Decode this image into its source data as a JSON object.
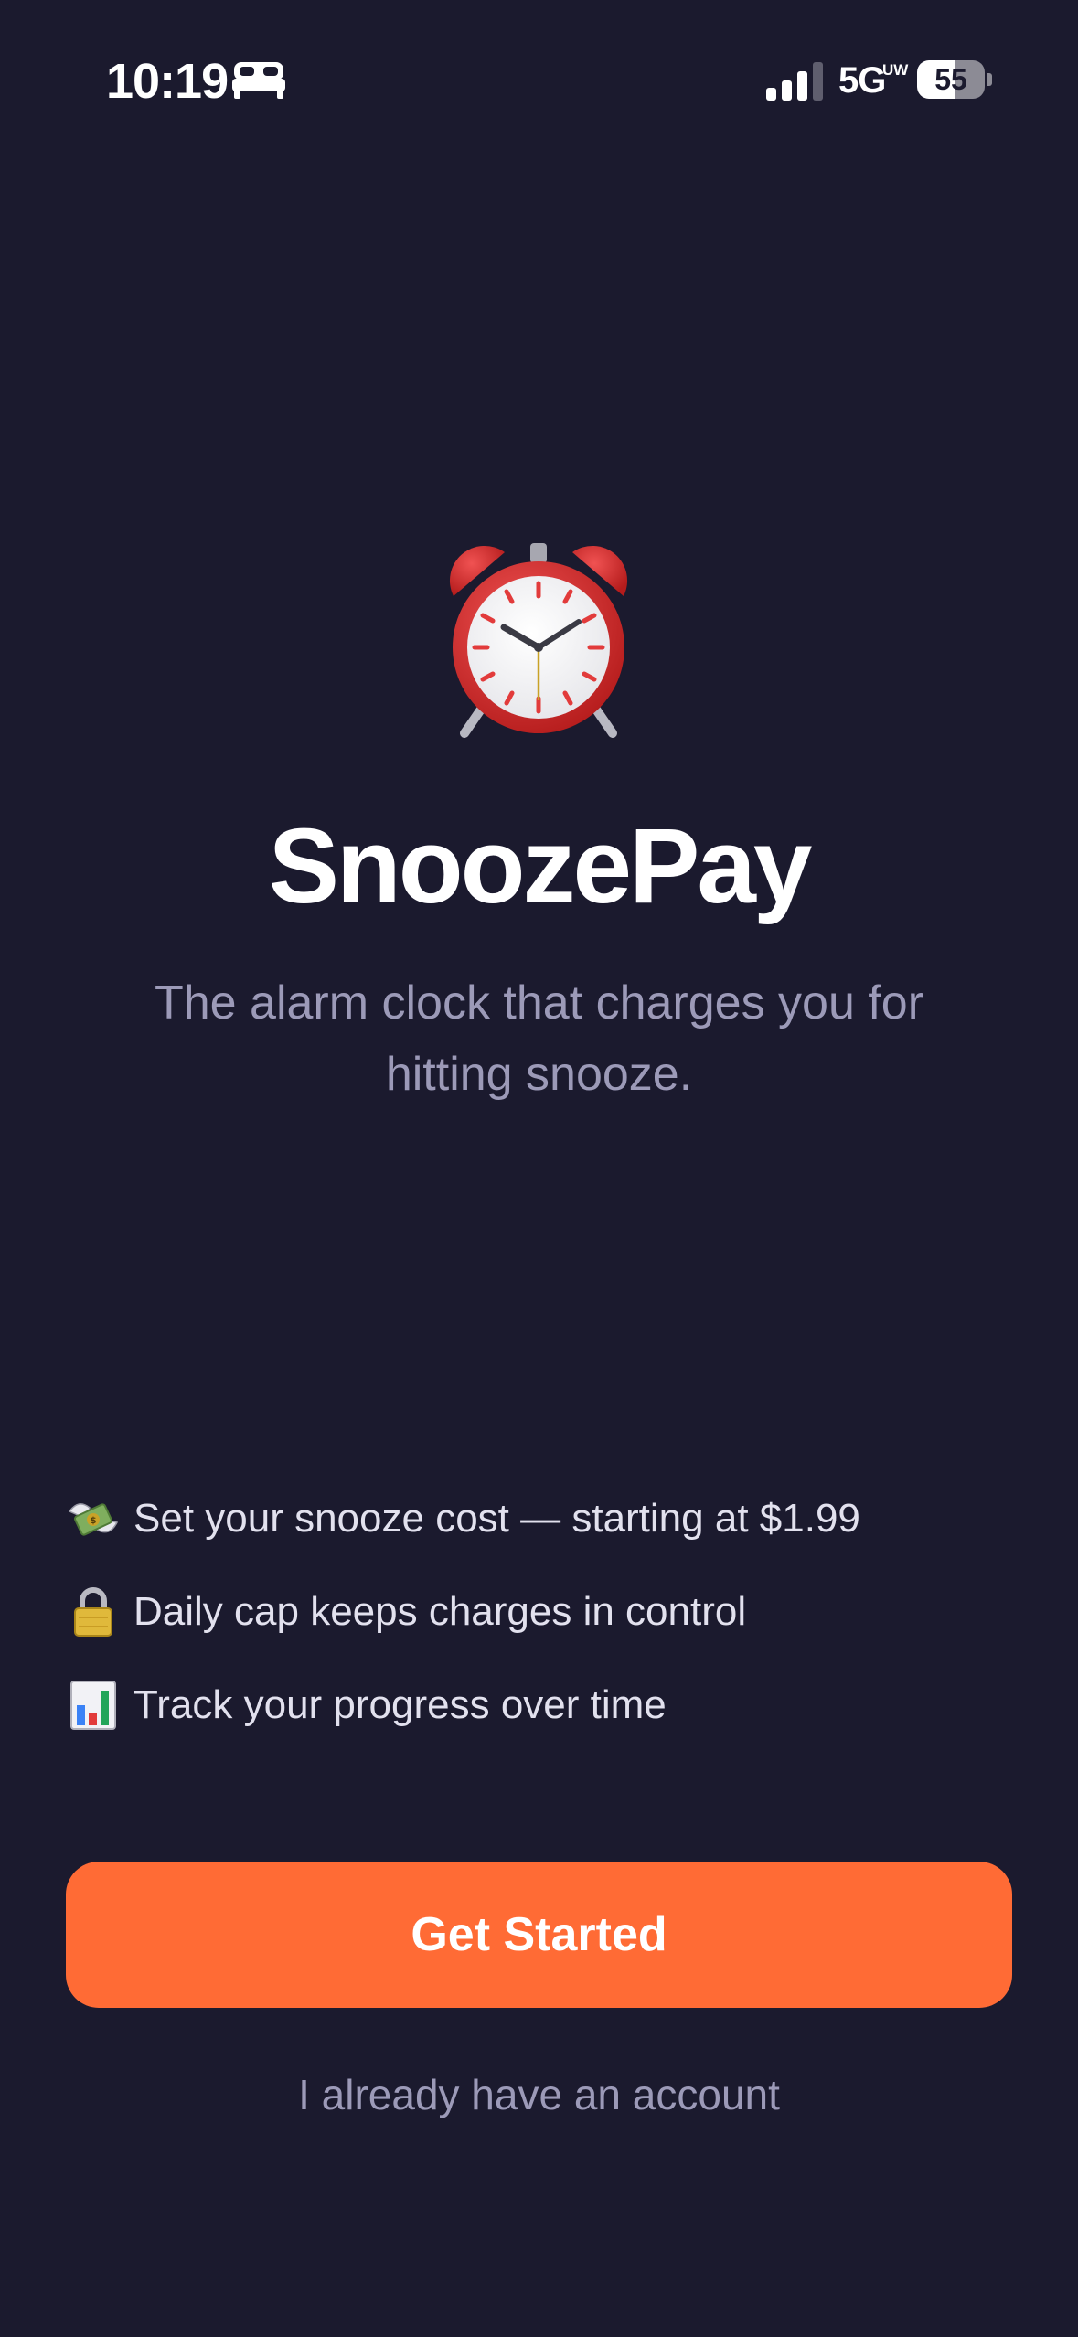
{
  "status_bar": {
    "time": "10:19",
    "network": "5G",
    "network_sub": "UW",
    "battery_percent": 55,
    "battery_label": "55",
    "focus_icon": "bed-icon",
    "signal_bars": 3
  },
  "hero": {
    "icon": "alarm-clock-icon",
    "title": "SnoozePay",
    "tagline": "The alarm clock that charges you for hitting snooze."
  },
  "features": [
    {
      "icon": "money-wings-icon",
      "text": "Set your snooze cost — starting at $1.99"
    },
    {
      "icon": "lock-icon",
      "text": "Daily cap keeps charges in control"
    },
    {
      "icon": "bar-chart-icon",
      "text": "Track your progress over time"
    }
  ],
  "actions": {
    "primary_label": "Get Started",
    "secondary_label": "I already have an account"
  },
  "colors": {
    "background": "#1b1a2e",
    "accent": "#ff6b35",
    "muted_text": "#9c9ab8"
  }
}
